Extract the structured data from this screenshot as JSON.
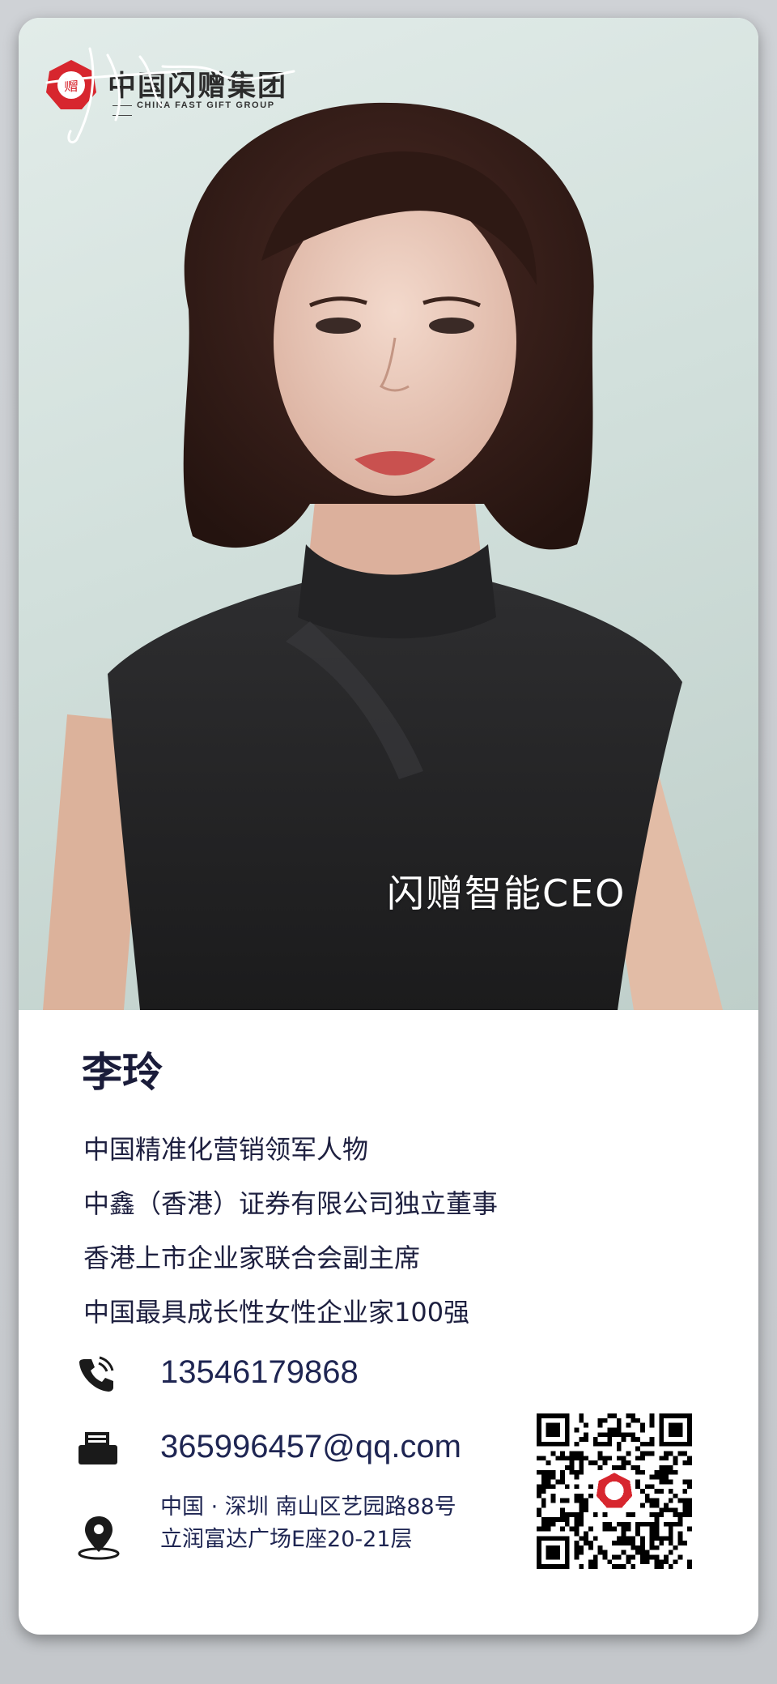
{
  "brand": {
    "name_cn": "中国闪赠集团",
    "name_en": "CHINA FAST GIFT GROUP",
    "seal_char": "赠",
    "color": "#d7262e"
  },
  "photo": {
    "signature_text": "李玲",
    "title": "闪赠智能CEO"
  },
  "profile": {
    "name": "李玲",
    "bio": [
      "中国精准化营销领军人物",
      "中鑫（香港）证券有限公司独立董事",
      "香港上市企业家联合会副主席",
      "中国最具成长性女性企业家100强"
    ]
  },
  "contact": {
    "phone": "13546179868",
    "email": "365996457@qq.com",
    "address_line1": "中国 · 深圳  南山区艺园路88号",
    "address_line2": "立润富达广场E座20-21层",
    "phone_icon": "phone-icon",
    "email_icon": "inbox-icon",
    "address_icon": "location-pin-icon"
  },
  "qr": {
    "icon": "qr-code"
  }
}
